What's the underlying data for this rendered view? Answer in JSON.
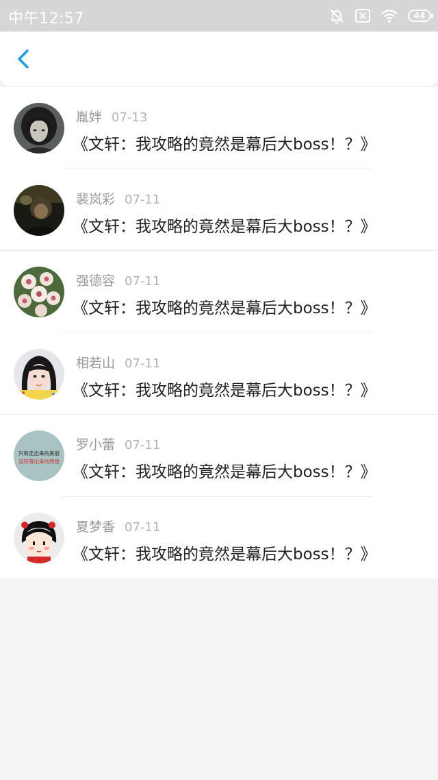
{
  "status_bar": {
    "time": "中午12:57",
    "battery": "44",
    "icons": [
      "mute-bell-icon",
      "sim-off-icon",
      "wifi-icon",
      "battery-icon"
    ]
  },
  "nav": {
    "back_icon": "chevron-left-icon"
  },
  "colors": {
    "accent": "#1a9be8",
    "status_bar": "#d6d6d6",
    "background": "#f5f5f5"
  },
  "messages": [
    {
      "name": "胤姅",
      "date": "07-13",
      "title": "《文轩：我攻略的竟然是幕后大boss！？》"
    },
    {
      "name": "裴岚彩",
      "date": "07-11",
      "title": "《文轩：我攻略的竟然是幕后大boss！？》"
    },
    {
      "name": "强德容",
      "date": "07-11",
      "title": "《文轩：我攻略的竟然是幕后大boss！？》"
    },
    {
      "name": "相若山",
      "date": "07-11",
      "title": "《文轩：我攻略的竟然是幕后大boss！？》"
    },
    {
      "name": "罗小蕾",
      "date": "07-11",
      "title": "《文轩：我攻略的竟然是幕后大boss！？》"
    },
    {
      "name": "夏梦香",
      "date": "07-11",
      "title": "《文轩：我攻略的竟然是幕后大boss！？》"
    }
  ],
  "avatar_text": {
    "line1": "只有走出来的美丽",
    "line2": "没有等出来的辉煌"
  }
}
